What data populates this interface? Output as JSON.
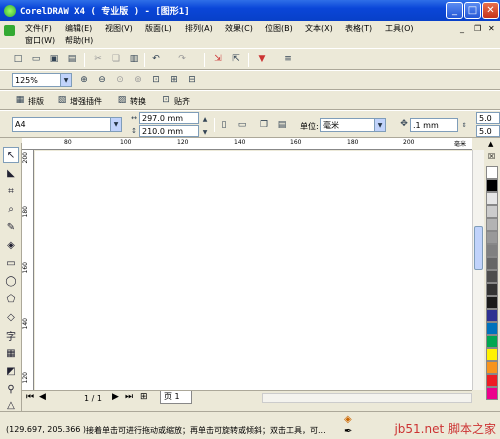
{
  "window": {
    "title": "CorelDRAW X4 ( 专业版 ) - [图形1]",
    "min_glyph": "_",
    "max_glyph": "□",
    "close_glyph": "✕"
  },
  "menu": {
    "items": [
      "文件(F)",
      "编辑(E)",
      "视图(V)",
      "版面(L)",
      "排列(A)",
      "效果(C)",
      "位图(B)",
      "文本(X)",
      "表格(T)",
      "工具(O)"
    ],
    "row2": [
      "窗口(W)",
      "帮助(H)"
    ]
  },
  "zoom": {
    "value": "125%"
  },
  "plugin_toolbar": {
    "items": [
      "排版",
      "增强插件",
      "转换",
      "贴齐"
    ]
  },
  "property_bar": {
    "paper_size": "A4",
    "width": "297.0 mm",
    "height": "210.0 mm",
    "units_label": "单位:",
    "units_value": "毫米",
    "nudge_value": ".1 mm",
    "dup_x": "5.0",
    "dup_y": "5.0"
  },
  "ruler": {
    "unit": "毫米",
    "h_labels": [
      "80",
      "100",
      "120",
      "140",
      "160",
      "180",
      "200"
    ],
    "v_labels": [
      "200",
      "180",
      "160",
      "140",
      "120",
      "100"
    ]
  },
  "page_nav": {
    "position": "1 / 1",
    "tab": "页 1"
  },
  "status": {
    "coords": "(129.697, 205.366 )",
    "hint": "接着单击可进行拖动或缩放；再单击可旋转或倾斜；双击工具，可..."
  },
  "watermark": {
    "line": "jb51.net 脚本之家"
  },
  "colors": {
    "titlebar": "#0a46d8",
    "chrome": "#ece9d8",
    "canvas": "#ffffff",
    "palette": [
      "#ffffff",
      "#000000",
      "#e6e6e6",
      "#cccccc",
      "#b3b3b3",
      "#999999",
      "#808080",
      "#666666",
      "#4d4d4d",
      "#333333",
      "#1a1a1a",
      "#2e3192",
      "#0072bc",
      "#00a651",
      "#fff200",
      "#f7941d",
      "#ed1c24",
      "#ec008c"
    ]
  }
}
